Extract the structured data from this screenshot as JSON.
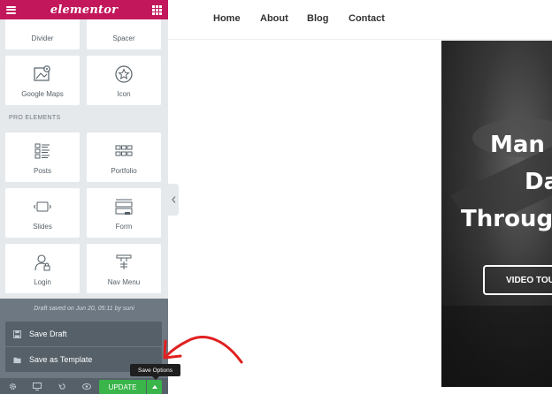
{
  "panel": {
    "logo": "elementor",
    "widgets_top": [
      {
        "label": "Divider",
        "icon": "divider-icon"
      },
      {
        "label": "Spacer",
        "icon": "spacer-icon"
      },
      {
        "label": "Google Maps",
        "icon": "google-maps-icon"
      },
      {
        "label": "Icon",
        "icon": "star-icon"
      }
    ],
    "pro_section_title": "PRO ELEMENTS",
    "widgets_pro": [
      {
        "label": "Posts",
        "icon": "posts-icon"
      },
      {
        "label": "Portfolio",
        "icon": "portfolio-icon"
      },
      {
        "label": "Slides",
        "icon": "slides-icon"
      },
      {
        "label": "Form",
        "icon": "form-icon"
      },
      {
        "label": "Login",
        "icon": "login-icon"
      },
      {
        "label": "Nav Menu",
        "icon": "nav-menu-icon"
      }
    ],
    "draft_note": "Draft saved on Jun 20, 05:11 by suni",
    "save_menu": {
      "save_draft": "Save Draft",
      "save_template": "Save as Template"
    },
    "update_label": "UPDATE",
    "tooltip": "Save Options"
  },
  "nav": {
    "links": [
      "Home",
      "About",
      "Blog",
      "Contact"
    ]
  },
  "hero": {
    "lines": [
      "Man",
      "Da",
      "Throug"
    ],
    "button": "VIDEO TOU"
  },
  "colors": {
    "brand": "#c2185b",
    "update": "#39b54a",
    "annotation": "#e02020"
  }
}
